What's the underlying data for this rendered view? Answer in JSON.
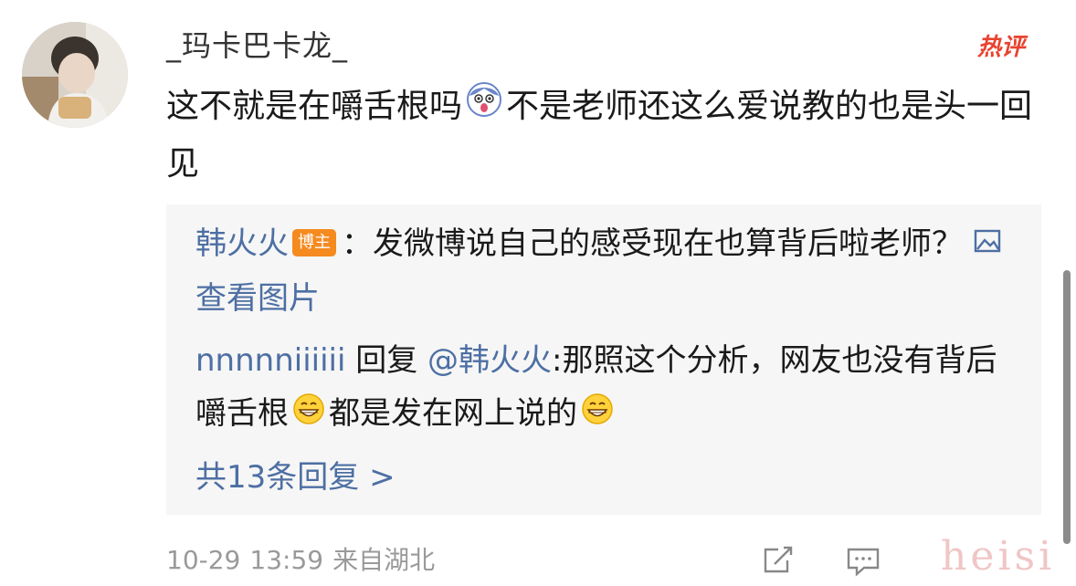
{
  "comment": {
    "username": "_玛卡巴卡龙_",
    "hot_badge": "热评",
    "text_before_emoji": "这不就是在嚼舌根吗",
    "emoji_icon": "surprised-face-emoji",
    "text_after_emoji": "不是老师还这么爱说教的也是头一回见"
  },
  "replies": {
    "reply1": {
      "author": "韩火火",
      "author_badge": "博主",
      "text": "：发微博说自己的感受现在也算背后啦老师？",
      "view_image_label": "查看图片",
      "view_image_icon": "image-icon"
    },
    "reply2": {
      "author": "nnnnniiiiii",
      "reply_word": " 回复 ",
      "mention": "@韩火火",
      "text_part1": ":那照这个分析，网友也没有背后嚼舌根",
      "emoji_icon": "grinning-face-emoji",
      "text_part2": "都是发在网上说的"
    },
    "more_replies_label": "共13条回复 >"
  },
  "footer": {
    "date": "10-29",
    "time": "13:59",
    "location": "来自湖北",
    "share_icon": "share-icon",
    "comment_icon": "comment-icon"
  },
  "watermark": "heisi",
  "colors": {
    "link": "#4d6fa3",
    "badge_orange": "#f58a1f",
    "hot_red": "#e8432f",
    "reply_background": "#f6f6f6",
    "meta_gray": "#9a9a9a"
  }
}
